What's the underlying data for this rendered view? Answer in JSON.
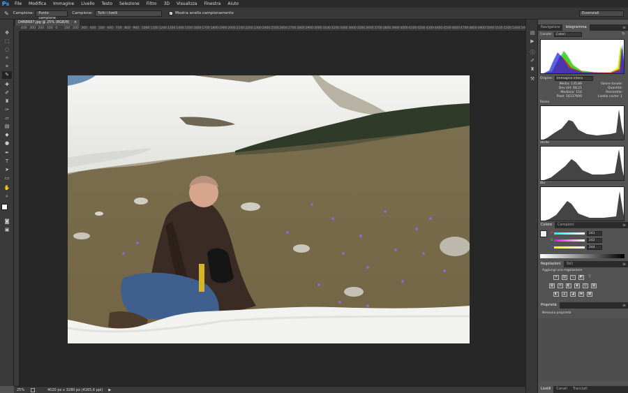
{
  "app": {
    "logo": "Ps"
  },
  "menu": [
    "File",
    "Modifica",
    "Immagine",
    "Livello",
    "Testo",
    "Selezione",
    "Filtro",
    "3D",
    "Visualizza",
    "Finestra",
    "Aiuto"
  ],
  "options": {
    "sample_label": "Campione:",
    "sample_value": "Punto campione",
    "sample2_label": "Campione:",
    "sample2_value": "Tutti i livelli",
    "ring_checkbox_label": "Mostra anello campionamento",
    "ring_checked": "✓",
    "workspace": "Essenziali"
  },
  "document": {
    "tab_title": "D4N8687.jpg @ 25% (RGB/8)",
    "tab_close": "×",
    "zoom": "25%",
    "info": "4020 px x 3280 px (4165,6 ppi)",
    "arrow": "▶"
  },
  "ruler": {
    "ticks": [
      "400",
      "300",
      "200",
      "100",
      "0",
      "100",
      "200",
      "300",
      "400",
      "500",
      "600",
      "700",
      "800",
      "900",
      "1000",
      "1100",
      "1200",
      "1300",
      "1400",
      "1500",
      "1600",
      "1700",
      "1800",
      "1900",
      "2000",
      "2100",
      "2200",
      "2300",
      "2400",
      "2500",
      "2600",
      "2700",
      "2800",
      "2900",
      "3000",
      "3100",
      "3200",
      "3300",
      "3400",
      "3500",
      "3600",
      "3700",
      "3800",
      "3900",
      "4000",
      "4100",
      "4200",
      "4300",
      "4400",
      "4500",
      "4600",
      "4700",
      "4800",
      "4900",
      "5000",
      "5100",
      "5200",
      "5300",
      "5400"
    ]
  },
  "panels": {
    "navigator_tab": "Navigatore",
    "histogram_tab": "Istogramma",
    "channel_label": "Canale:",
    "channel_value": "Colori",
    "origin_label": "Origine:",
    "origin_value": "Immagine intera",
    "stats": {
      "media_label": "Media:",
      "media_value": "135,89",
      "dev_label": "Dev std:",
      "dev_value": "68,21",
      "mediana_label": "Mediana:",
      "mediana_value": "116",
      "pixel_label": "Pixel:",
      "pixel_value": "16137600",
      "valore_label": "Valore tonale:",
      "quantita_label": "Quantità:",
      "percentile_label": "Percentile:",
      "cache_label": "Livello cache:",
      "cache_value": "1"
    },
    "channels": [
      "Rosso",
      "Verde",
      "Blu"
    ],
    "color_tab": "Colore",
    "swatches_tab": "Campioni",
    "rgb": [
      {
        "label": "R",
        "value": "241",
        "color": "#f05050"
      },
      {
        "label": "G",
        "value": "242",
        "color": "#50f050"
      },
      {
        "label": "B",
        "value": "244",
        "color": "#5050f0"
      }
    ],
    "adjustments_tab": "Regolazioni",
    "styles_tab": "Stili",
    "adjust_title": "Aggiungi una regolazione",
    "properties_tab": "Proprietà",
    "no_properties": "Nessuna proprietà",
    "layers_tab": "Livelli",
    "channels_tab": "Canali",
    "paths_tab": "Tracciati"
  }
}
